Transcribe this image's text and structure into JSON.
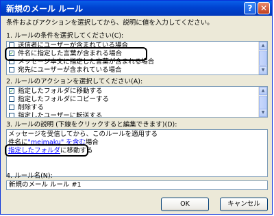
{
  "window": {
    "title": "新規のメール ルール",
    "help_glyph": "?",
    "close_glyph": "✕"
  },
  "instructions": "条件およびアクションを選択してから、説明に値を入力してください。",
  "step1": {
    "label": "1. ルールの条件を選択してください(C):",
    "items": [
      {
        "label": "送信者にユーザーが含まれている場合",
        "checked": false
      },
      {
        "label": "件名に指定した言葉が含まれる場合",
        "checked": true
      },
      {
        "label": "メッセージ本文に指定した言葉が含まれる場合",
        "checked": false
      },
      {
        "label": "宛先にユーザーが含まれている場合",
        "checked": false
      }
    ]
  },
  "step2": {
    "label": "2. ルールのアクションを選択してください(A):",
    "items": [
      {
        "label": "指定したフォルダに移動する",
        "checked": true
      },
      {
        "label": "指定したフォルダにコピーする",
        "checked": false
      },
      {
        "label": "削除する",
        "checked": false
      },
      {
        "label": "指定したユーザーに転送する",
        "checked": false
      }
    ]
  },
  "step3": {
    "label": "3. ルールの説明 (下線をクリックすると編集できます)(D):",
    "line1": "メッセージを受信してから、このルールを適用する",
    "line2_prefix": "件名に",
    "line2_link": "\"meimaku\" を含む",
    "line2_suffix": "場合",
    "line3_link": "指定したフォルダ",
    "line3_suffix": "に移動する"
  },
  "step4": {
    "label": "4. ルール名(N):",
    "value": "新規のメール ルール #1"
  },
  "buttons": {
    "ok": "OK",
    "cancel": "キャンセル"
  },
  "check_glyph": "✓",
  "scroll_up_glyph": "▲",
  "scroll_down_glyph": "▼"
}
